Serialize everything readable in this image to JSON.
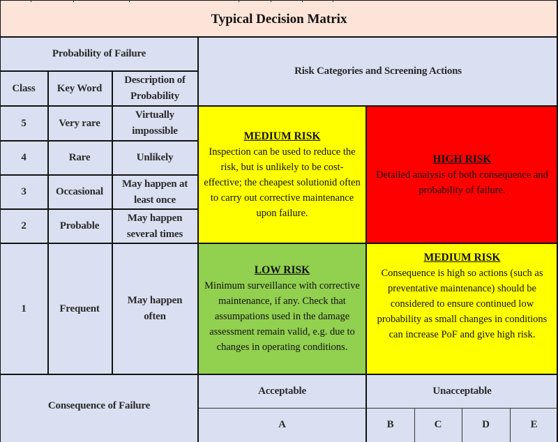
{
  "title": "Typical Decision Matrix",
  "probability_header": "Probability of Failure",
  "risk_header": "Risk Categories and Screening Actions",
  "columns": {
    "class": "Class",
    "key_word": "Key Word",
    "description": "Description of Probability"
  },
  "rows": [
    {
      "class": "5",
      "key_word": "Very rare",
      "description": "Virtually impossible"
    },
    {
      "class": "4",
      "key_word": "Rare",
      "description": "Unlikely"
    },
    {
      "class": "3",
      "key_word": "Occasional",
      "description": "May happen at least once"
    },
    {
      "class": "2",
      "key_word": "Probable",
      "description": "May happen several times"
    },
    {
      "class": "1",
      "key_word": "Frequent",
      "description": "May happen often"
    }
  ],
  "risk_cells": {
    "upper_left": {
      "title": "MEDIUM RISK",
      "text": "Inspection can be used to reduce the risk, but is unlikely to be cost-effective; the cheapest solutionid often to carry out corrective maintenance upon failure.",
      "color": "#ffff00"
    },
    "upper_right": {
      "title": "HIGH RISK",
      "text": "Detailed analysis of both consequence and probability of failure.",
      "color": "#ff0000"
    },
    "lower_left": {
      "title": "LOW RISK",
      "text": "Minimum surveillance with corrective maintenance, if any. Check that assumpations used in the damage assessment remain valid, e.g. due to changes in operating conditions.",
      "color": "#92d050"
    },
    "lower_right": {
      "title": "MEDIUM RISK",
      "text": "Consequence is high so actions (such as preventative maintenance) should be considered to ensure continued low probability as small changes in conditions can increase PoF and give high risk.",
      "color": "#ffff00"
    }
  },
  "consequence": {
    "label": "Consequence of Failure",
    "acceptable": "Acceptable",
    "unacceptable": "Unacceptable",
    "classes": [
      "A",
      "B",
      "C",
      "D",
      "E"
    ]
  }
}
